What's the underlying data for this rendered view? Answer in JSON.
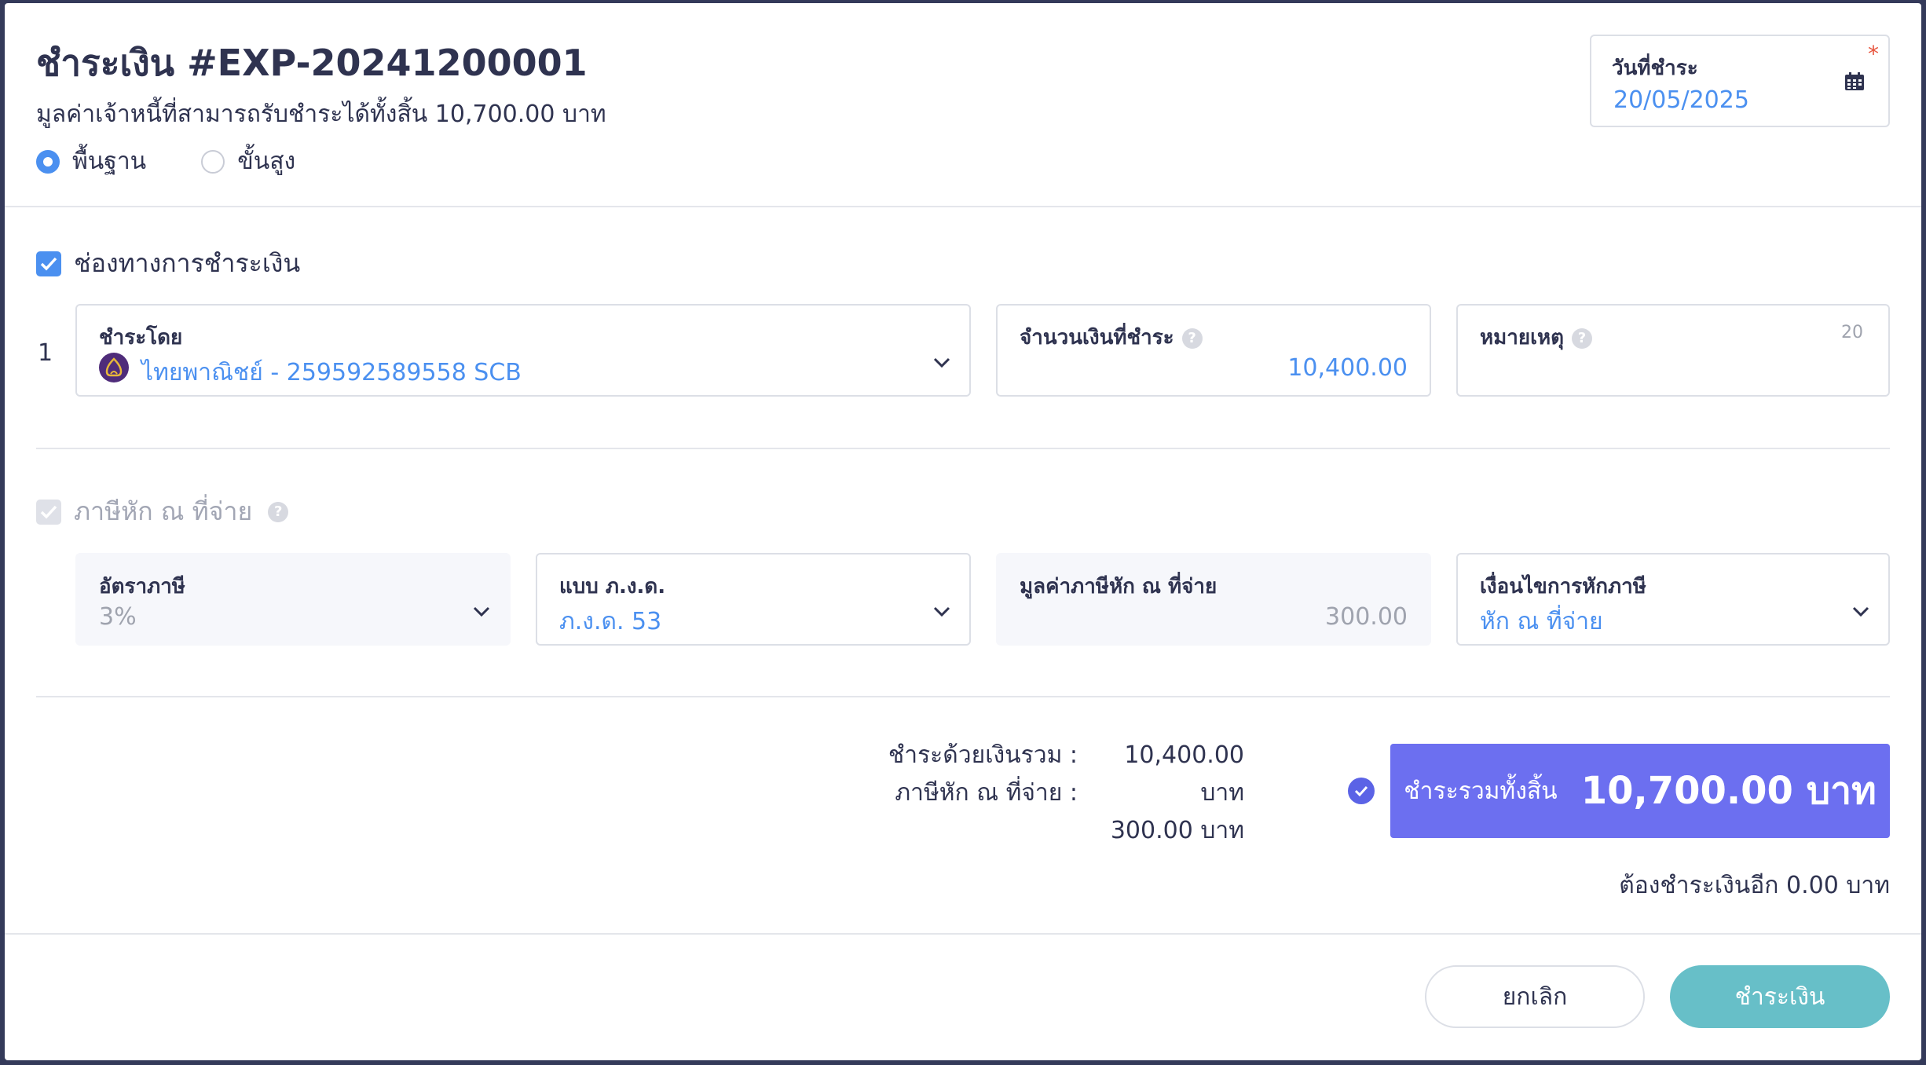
{
  "header": {
    "title": "ชำระเงิน #EXP-20241200001",
    "subtitle": "มูลค่าเจ้าหนี้ที่สามารถรับชำระได้ทั้งสิ้น 10,700.00 บาท",
    "mode_options": [
      {
        "label": "พื้นฐาน",
        "selected": true
      },
      {
        "label": "ขั้นสูง",
        "selected": false
      }
    ],
    "payment_date": {
      "label": "วันที่ชำระ",
      "value": "20/05/2025",
      "required_mark": "*"
    }
  },
  "payment_channel": {
    "label": "ช่องทางการชำระเงิน",
    "checked": true,
    "row_number": "1",
    "pay_by": {
      "label": "ชำระโดย",
      "value": "ไทยพาณิชย์ - 259592589558 SCB"
    },
    "amount": {
      "label": "จำนวนเงินที่ชำระ",
      "value": "10,400.00"
    },
    "note": {
      "label": "หมายเหตุ",
      "counter": "20",
      "value": ""
    }
  },
  "withholding_tax": {
    "label": "ภาษีหัก ณ ที่จ่าย",
    "checked": true,
    "disabled": true,
    "rate": {
      "label": "อัตราภาษี",
      "value": "3%"
    },
    "form": {
      "label": "แบบ ภ.ง.ด.",
      "value": "ภ.ง.ด. 53"
    },
    "tax_amount": {
      "label": "มูลค่าภาษีหัก ณ ที่จ่าย",
      "value": "300.00"
    },
    "condition": {
      "label": "เงื่อนไขการหักภาษี",
      "value": "หัก ณ ที่จ่าย"
    }
  },
  "summary": {
    "paid_total_label": "ชำระด้วยเงินรวม :",
    "paid_total_value": "10,400.00 บาท",
    "tax_label": "ภาษีหัก ณ ที่จ่าย :",
    "tax_value": "300.00 บาท",
    "grand_total_label": "ชำระรวมทั้งสิ้น",
    "grand_total_value": "10,700.00 บาท",
    "remaining": "ต้องชำระเงินอีก 0.00 บาท"
  },
  "footer": {
    "cancel_label": "ยกเลิก",
    "pay_label": "ชำระเงิน"
  },
  "colors": {
    "accent": "#4b90f0",
    "total_box": "#6c6ff0",
    "pay_button": "#67bfc8",
    "required": "#e8553e"
  }
}
